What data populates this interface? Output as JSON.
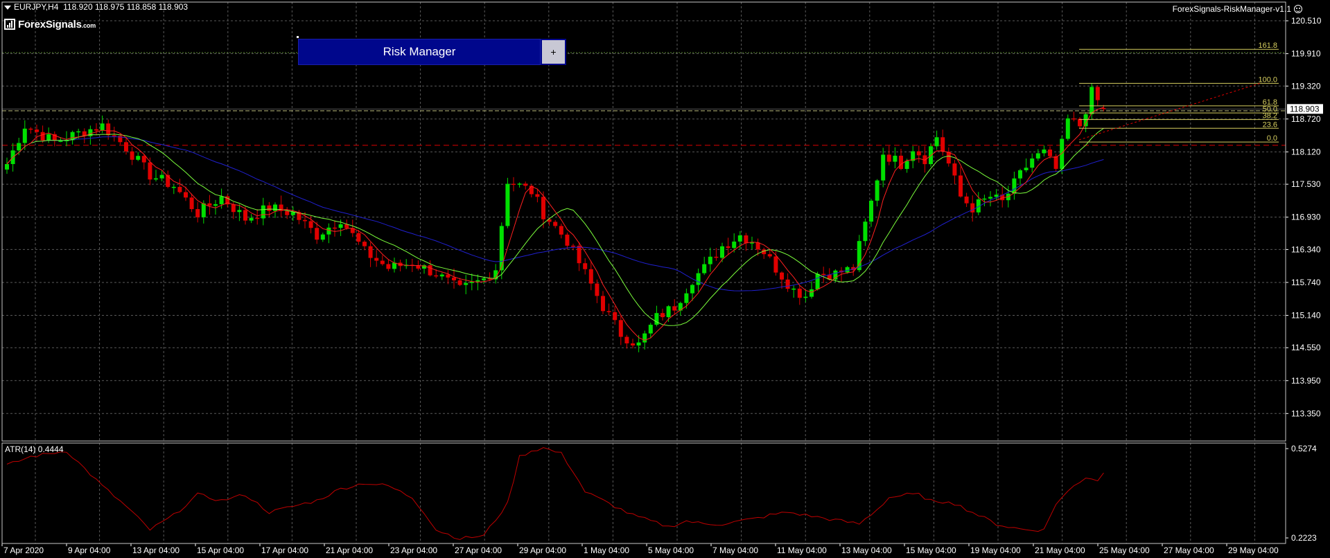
{
  "header": {
    "symbol_line": "EURJPY,H4  118.920 118.975 118.858 118.903",
    "logo_text": "ForexSignals",
    "logo_suffix": ".com",
    "ea_name": "ForexSignals-RiskManager-v1.1"
  },
  "risk_manager": {
    "title": "Risk Manager",
    "expand_label": "+"
  },
  "indicator": {
    "label": "ATR(14) 0.4444"
  },
  "colors": {
    "background": "#000000",
    "grid": "#5a5a5a",
    "bull_candle": "#00e000",
    "bear_candle": "#e00000",
    "ma_fast": "#ff2020",
    "ma_mid": "#7cff3c",
    "ma_slow": "#2020d0",
    "fib": "#d8d060",
    "price_line": "#c0c080",
    "atr_line": "#c00000",
    "panel_blue": "#00078c"
  },
  "chart_data": {
    "type": "candlestick",
    "symbol": "EURJPY",
    "timeframe": "H4",
    "ohlc_current": {
      "open": 118.92,
      "high": 118.975,
      "low": 118.858,
      "close": 118.903
    },
    "current_price_label": "118.903",
    "y_ticks": [
      "120.510",
      "119.910",
      "119.320",
      "118.720",
      "118.120",
      "117.530",
      "116.930",
      "116.340",
      "115.740",
      "115.140",
      "114.550",
      "113.950",
      "113.350"
    ],
    "y_tick_values": [
      120.51,
      119.91,
      119.32,
      118.72,
      118.12,
      117.53,
      116.93,
      116.34,
      115.74,
      115.14,
      114.55,
      113.95,
      113.35
    ],
    "ylim": [
      112.95,
      120.75
    ],
    "x_ticks": [
      "7 Apr 2020",
      "9 Apr 04:00",
      "13 Apr 04:00",
      "15 Apr 04:00",
      "17 Apr 04:00",
      "21 Apr 04:00",
      "23 Apr 04:00",
      "27 Apr 04:00",
      "29 Apr 04:00",
      "1 May 04:00",
      "5 May 04:00",
      "7 May 04:00",
      "11 May 04:00",
      "13 May 04:00",
      "15 May 04:00",
      "19 May 04:00",
      "21 May 04:00",
      "25 May 04:00",
      "27 May 04:00",
      "29 May 04:00"
    ],
    "anchors": [
      [
        0,
        117.9
      ],
      [
        3,
        118.6
      ],
      [
        8,
        118.3
      ],
      [
        13,
        118.5
      ],
      [
        16,
        118.6
      ],
      [
        20,
        118.2
      ],
      [
        24,
        117.7
      ],
      [
        28,
        117.5
      ],
      [
        32,
        117.0
      ],
      [
        36,
        117.3
      ],
      [
        40,
        116.9
      ],
      [
        44,
        117.1
      ],
      [
        48,
        117.0
      ],
      [
        52,
        116.6
      ],
      [
        56,
        116.9
      ],
      [
        60,
        116.3
      ],
      [
        64,
        116.0
      ],
      [
        68,
        116.1
      ],
      [
        72,
        115.9
      ],
      [
        76,
        115.6
      ],
      [
        80,
        115.8
      ],
      [
        82,
        116.0
      ],
      [
        84,
        117.6
      ],
      [
        88,
        117.4
      ],
      [
        90,
        117.0
      ],
      [
        94,
        116.5
      ],
      [
        97,
        115.9
      ],
      [
        100,
        115.3
      ],
      [
        103,
        114.8
      ],
      [
        106,
        114.6
      ],
      [
        109,
        115.1
      ],
      [
        112,
        115.3
      ],
      [
        115,
        115.8
      ],
      [
        117,
        116.0
      ],
      [
        120,
        116.4
      ],
      [
        123,
        116.6
      ],
      [
        125,
        116.5
      ],
      [
        127,
        116.3
      ],
      [
        129,
        116.0
      ],
      [
        132,
        115.6
      ],
      [
        134,
        115.5
      ],
      [
        136,
        115.9
      ],
      [
        139,
        115.9
      ],
      [
        142,
        116.0
      ],
      [
        145,
        117.2
      ],
      [
        147,
        118.1
      ],
      [
        150,
        117.9
      ],
      [
        152,
        118.2
      ],
      [
        154,
        118.0
      ],
      [
        156,
        118.4
      ],
      [
        158,
        117.9
      ],
      [
        160,
        117.3
      ],
      [
        162,
        117.1
      ],
      [
        165,
        117.3
      ],
      [
        167,
        117.2
      ],
      [
        170,
        117.7
      ],
      [
        172,
        118.0
      ],
      [
        174,
        118.1
      ],
      [
        176,
        117.8
      ],
      [
        178,
        118.7
      ],
      [
        180,
        118.6
      ],
      [
        182,
        119.2
      ],
      [
        184,
        118.903
      ]
    ],
    "fibonacci": {
      "levels": [
        {
          "label": "161.8",
          "value": 119.99
        },
        {
          "label": "100.0",
          "value": 119.37
        },
        {
          "label": "61.8",
          "value": 118.96
        },
        {
          "label": "50.0",
          "value": 118.83
        },
        {
          "label": "38.2",
          "value": 118.71
        },
        {
          "label": "23.6",
          "value": 118.55
        },
        {
          "label": "0.0",
          "value": 118.3
        }
      ]
    },
    "horizontal_levels": [
      118.87,
      118.24
    ],
    "atr": {
      "label": "ATR(14) 0.4444",
      "y_ticks": [
        "0.5274",
        "0.2223"
      ],
      "ylim": [
        0.2223,
        0.5274
      ],
      "anchors": [
        [
          0,
          0.47
        ],
        [
          4,
          0.5
        ],
        [
          10,
          0.52
        ],
        [
          16,
          0.4
        ],
        [
          20,
          0.33
        ],
        [
          24,
          0.25
        ],
        [
          28,
          0.3
        ],
        [
          32,
          0.37
        ],
        [
          36,
          0.35
        ],
        [
          40,
          0.37
        ],
        [
          44,
          0.31
        ],
        [
          48,
          0.33
        ],
        [
          52,
          0.35
        ],
        [
          56,
          0.39
        ],
        [
          60,
          0.41
        ],
        [
          64,
          0.4
        ],
        [
          68,
          0.36
        ],
        [
          70,
          0.31
        ],
        [
          72,
          0.25
        ],
        [
          76,
          0.22
        ],
        [
          80,
          0.23
        ],
        [
          84,
          0.34
        ],
        [
          86,
          0.5
        ],
        [
          88,
          0.52
        ],
        [
          90,
          0.53
        ],
        [
          93,
          0.51
        ],
        [
          95,
          0.45
        ],
        [
          97,
          0.38
        ],
        [
          99,
          0.36
        ],
        [
          102,
          0.33
        ],
        [
          105,
          0.3
        ],
        [
          108,
          0.28
        ],
        [
          111,
          0.26
        ],
        [
          114,
          0.28
        ],
        [
          117,
          0.27
        ],
        [
          120,
          0.27
        ],
        [
          123,
          0.28
        ],
        [
          126,
          0.29
        ],
        [
          128,
          0.3
        ],
        [
          131,
          0.31
        ],
        [
          134,
          0.3
        ],
        [
          137,
          0.29
        ],
        [
          140,
          0.28
        ],
        [
          143,
          0.27
        ],
        [
          146,
          0.32
        ],
        [
          148,
          0.36
        ],
        [
          151,
          0.37
        ],
        [
          153,
          0.37
        ],
        [
          156,
          0.34
        ],
        [
          158,
          0.35
        ],
        [
          160,
          0.33
        ],
        [
          163,
          0.3
        ],
        [
          166,
          0.27
        ],
        [
          168,
          0.26
        ],
        [
          171,
          0.25
        ],
        [
          174,
          0.25
        ],
        [
          176,
          0.34
        ],
        [
          179,
          0.4
        ],
        [
          181,
          0.43
        ],
        [
          183,
          0.42
        ],
        [
          184,
          0.4444
        ]
      ]
    }
  }
}
